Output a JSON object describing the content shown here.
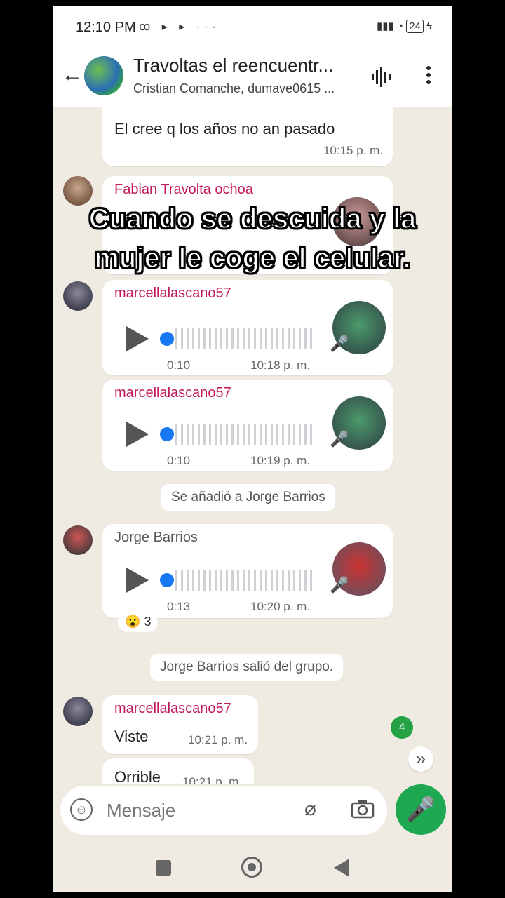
{
  "status_bar": {
    "time": "12:10 PM",
    "left_icons": "ꝏ ▸ ▸ ···",
    "battery": "24"
  },
  "header": {
    "title": "Travoltas el reencuentr...",
    "subtitle": "Cristian Comanche, dumave0615 ..."
  },
  "messages": [
    {
      "text": "El cree q los años no an pasado",
      "time": "10:15 p. m."
    },
    {
      "sender": "Fabian Travolta ochoa",
      "sender_color": "#c2185b"
    },
    {
      "sender": "marcellalascano57",
      "sender_color": "#c2185b",
      "duration": "0:10",
      "time": "10:18 p. m."
    },
    {
      "sender": "marcellalascano57",
      "sender_color": "#c2185b",
      "duration": "0:10",
      "time": "10:19 p. m."
    },
    {
      "system": "Se añadió a Jorge Barrios"
    },
    {
      "sender": "Jorge Barrios",
      "sender_color": "#555555",
      "duration": "0:13",
      "time": "10:20 p. m.",
      "reaction": "😮",
      "reaction_count": "3"
    },
    {
      "system": "Jorge Barrios salió del grupo."
    },
    {
      "sender": "marcellalascano57",
      "sender_color": "#c2185b",
      "text": "Viste",
      "time": "10:21 p. m."
    },
    {
      "text": "Orrible",
      "time": "10:21 p. m."
    }
  ],
  "overlay_caption": {
    "line1": "Cuando se descuida y la",
    "line2": "mujer le coge el celular."
  },
  "unread_badge": "4",
  "input": {
    "placeholder": "Mensaje"
  },
  "colors": {
    "accent": "#1da851",
    "chat_bg": "#efeae2"
  }
}
